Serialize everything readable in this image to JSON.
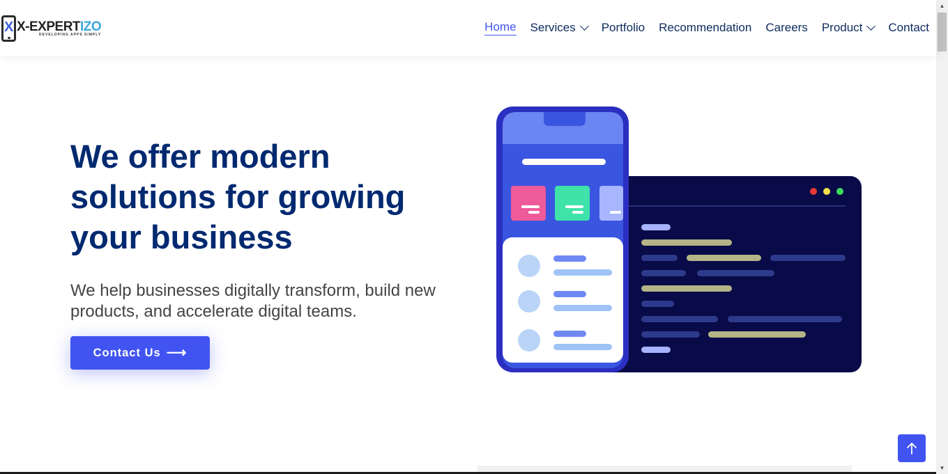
{
  "brand": {
    "name_prefix": "X-",
    "name_main": "EXPERT",
    "name_highlight": "IZO",
    "tagline": "DEVELOPING APPS SIMPLY"
  },
  "nav": {
    "items": [
      {
        "label": "Home",
        "active": true,
        "dropdown": false
      },
      {
        "label": "Services",
        "active": false,
        "dropdown": true
      },
      {
        "label": "Portfolio",
        "active": false,
        "dropdown": false
      },
      {
        "label": "Recommendation",
        "active": false,
        "dropdown": false
      },
      {
        "label": "Careers",
        "active": false,
        "dropdown": false
      },
      {
        "label": "Product",
        "active": false,
        "dropdown": true
      },
      {
        "label": "Contact",
        "active": false,
        "dropdown": false
      }
    ]
  },
  "hero": {
    "title": "We offer modern solutions for growing your business",
    "subtitle": "We help businesses digitally transform, build new products, and accelerate digital teams.",
    "cta_label": "Contact Us",
    "cta_arrow": "⟶"
  },
  "colors": {
    "accent": "#4154f1",
    "heading": "#012970",
    "nav_text": "#0d2a5e"
  },
  "icons": {
    "cta": "arrow-right-icon",
    "back_to_top": "arrow-up-icon",
    "dropdown": "chevron-down-icon"
  }
}
